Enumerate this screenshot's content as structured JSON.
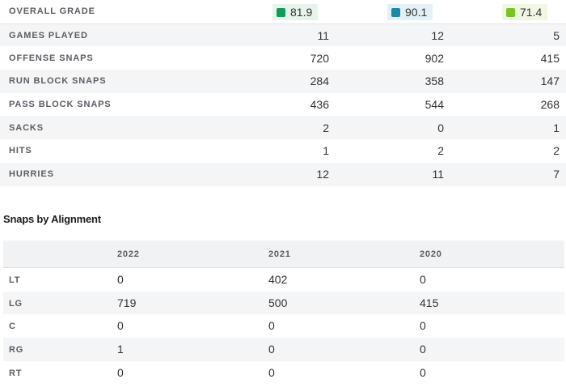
{
  "stats": {
    "grade": {
      "label": "OVERALL GRADE",
      "values": [
        "81.9",
        "90.1",
        "71.4"
      ],
      "colors": [
        "#0f9d58",
        "#1b8aa6",
        "#7cc223"
      ]
    },
    "rows": [
      {
        "label": "GAMES PLAYED",
        "values": [
          "11",
          "12",
          "5"
        ]
      },
      {
        "label": "OFFENSE SNAPS",
        "values": [
          "720",
          "902",
          "415"
        ]
      },
      {
        "label": "RUN BLOCK SNAPS",
        "values": [
          "284",
          "358",
          "147"
        ]
      },
      {
        "label": "PASS BLOCK SNAPS",
        "values": [
          "436",
          "544",
          "268"
        ]
      },
      {
        "label": "SACKS",
        "values": [
          "2",
          "0",
          "1"
        ]
      },
      {
        "label": "HITS",
        "values": [
          "1",
          "2",
          "2"
        ]
      },
      {
        "label": "HURRIES",
        "values": [
          "12",
          "11",
          "7"
        ]
      }
    ]
  },
  "alignment": {
    "title": "Snaps by Alignment",
    "headers": [
      "2022",
      "2021",
      "2020"
    ],
    "rows": [
      {
        "label": "LT",
        "values": [
          "0",
          "402",
          "0"
        ]
      },
      {
        "label": "LG",
        "values": [
          "719",
          "500",
          "415"
        ]
      },
      {
        "label": "C",
        "values": [
          "0",
          "0",
          "0"
        ]
      },
      {
        "label": "RG",
        "values": [
          "1",
          "0",
          "0"
        ]
      },
      {
        "label": "RT",
        "values": [
          "0",
          "0",
          "0"
        ]
      }
    ]
  }
}
